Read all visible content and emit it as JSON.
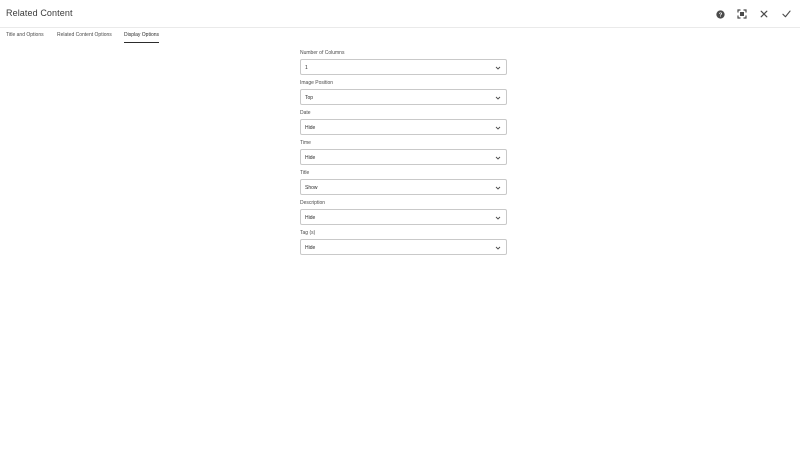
{
  "header": {
    "title": "Related Content"
  },
  "icons": {
    "help": "help-icon",
    "fullscreen": "fullscreen-icon",
    "close": "close-icon",
    "done": "checkmark-icon"
  },
  "tabs": [
    {
      "label": "Title and Options",
      "active": false
    },
    {
      "label": "Related Content Options",
      "active": false
    },
    {
      "label": "Display Options",
      "active": true
    }
  ],
  "fields": [
    {
      "label": "Number of Columns",
      "value": "1"
    },
    {
      "label": "Image Position",
      "value": "Top"
    },
    {
      "label": "Date",
      "value": "Hide"
    },
    {
      "label": "Time",
      "value": "Hide"
    },
    {
      "label": "Title",
      "value": "Show"
    },
    {
      "label": "Description",
      "value": "Hide"
    },
    {
      "label": "Tag (s)",
      "value": "Hide"
    }
  ]
}
